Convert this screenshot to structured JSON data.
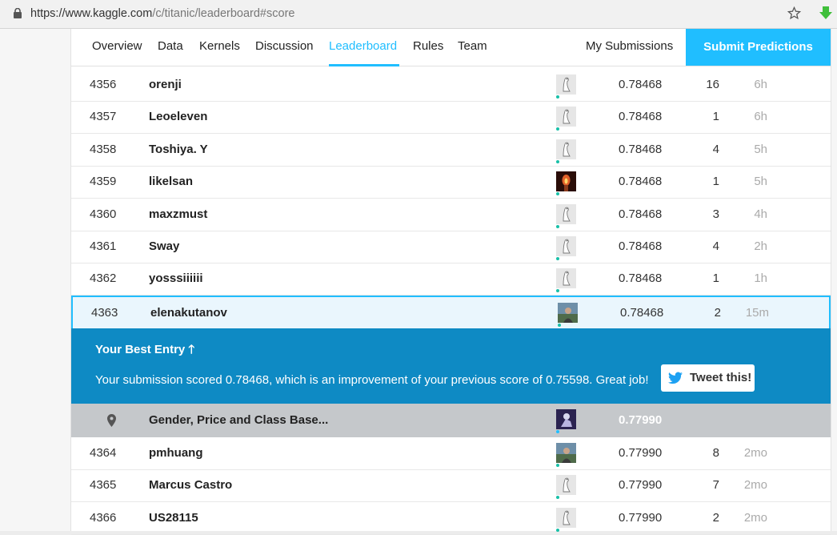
{
  "browser": {
    "url_host": "https://www.kaggle.com",
    "url_path": "/c/titanic/leaderboard#score"
  },
  "nav": {
    "tabs": [
      "Overview",
      "Data",
      "Kernels",
      "Discussion",
      "Leaderboard",
      "Rules",
      "Team"
    ],
    "active_tab": "Leaderboard",
    "my_submissions": "My Submissions",
    "submit_predictions": "Submit Predictions"
  },
  "rows_top": [
    {
      "rank": "4356",
      "name": "orenji",
      "score": "0.78468",
      "entries": "16",
      "last": "6h",
      "avatar": "goose-avatar-icon"
    },
    {
      "rank": "4357",
      "name": "Leoeleven",
      "score": "0.78468",
      "entries": "1",
      "last": "6h",
      "avatar": "goose-avatar-icon"
    },
    {
      "rank": "4358",
      "name": "Toshiya. Y",
      "score": "0.78468",
      "entries": "4",
      "last": "5h",
      "avatar": "goose-avatar-icon"
    },
    {
      "rank": "4359",
      "name": "likelsan",
      "score": "0.78468",
      "entries": "1",
      "last": "5h",
      "avatar": "candle-avatar"
    },
    {
      "rank": "4360",
      "name": "maxzmust",
      "score": "0.78468",
      "entries": "3",
      "last": "4h",
      "avatar": "goose-avatar-icon"
    },
    {
      "rank": "4361",
      "name": "Sway",
      "score": "0.78468",
      "entries": "4",
      "last": "2h",
      "avatar": "goose-avatar-icon"
    },
    {
      "rank": "4362",
      "name": "yosssiiiiii",
      "score": "0.78468",
      "entries": "1",
      "last": "1h",
      "avatar": "goose-avatar-icon"
    },
    {
      "rank": "4363",
      "name": "elenakutanov",
      "score": "0.78468",
      "entries": "2",
      "last": "15m",
      "avatar": "photo-avatar"
    }
  ],
  "best_entry": {
    "title": "Your Best Entry",
    "message": "Your submission scored 0.78468, which is an improvement of your previous score of 0.75598. Great job!",
    "tweet_label": "Tweet this!"
  },
  "benchmark": {
    "name": "Gender, Price and Class Base...",
    "score": "0.77990",
    "icon": "map-pin-icon"
  },
  "rows_bottom": [
    {
      "rank": "4364",
      "name": "pmhuang",
      "score": "0.77990",
      "entries": "8",
      "last": "2mo",
      "avatar": "photo-avatar"
    },
    {
      "rank": "4365",
      "name": "Marcus Castro",
      "score": "0.77990",
      "entries": "7",
      "last": "2mo",
      "avatar": "goose-avatar-icon"
    },
    {
      "rank": "4366",
      "name": "US28115",
      "score": "0.77990",
      "entries": "2",
      "last": "2mo",
      "avatar": "goose-avatar-icon"
    }
  ],
  "colors": {
    "accent": "#20beff",
    "best_panel": "#0e8ac4",
    "benchmark_row": "#c5c8cb"
  }
}
